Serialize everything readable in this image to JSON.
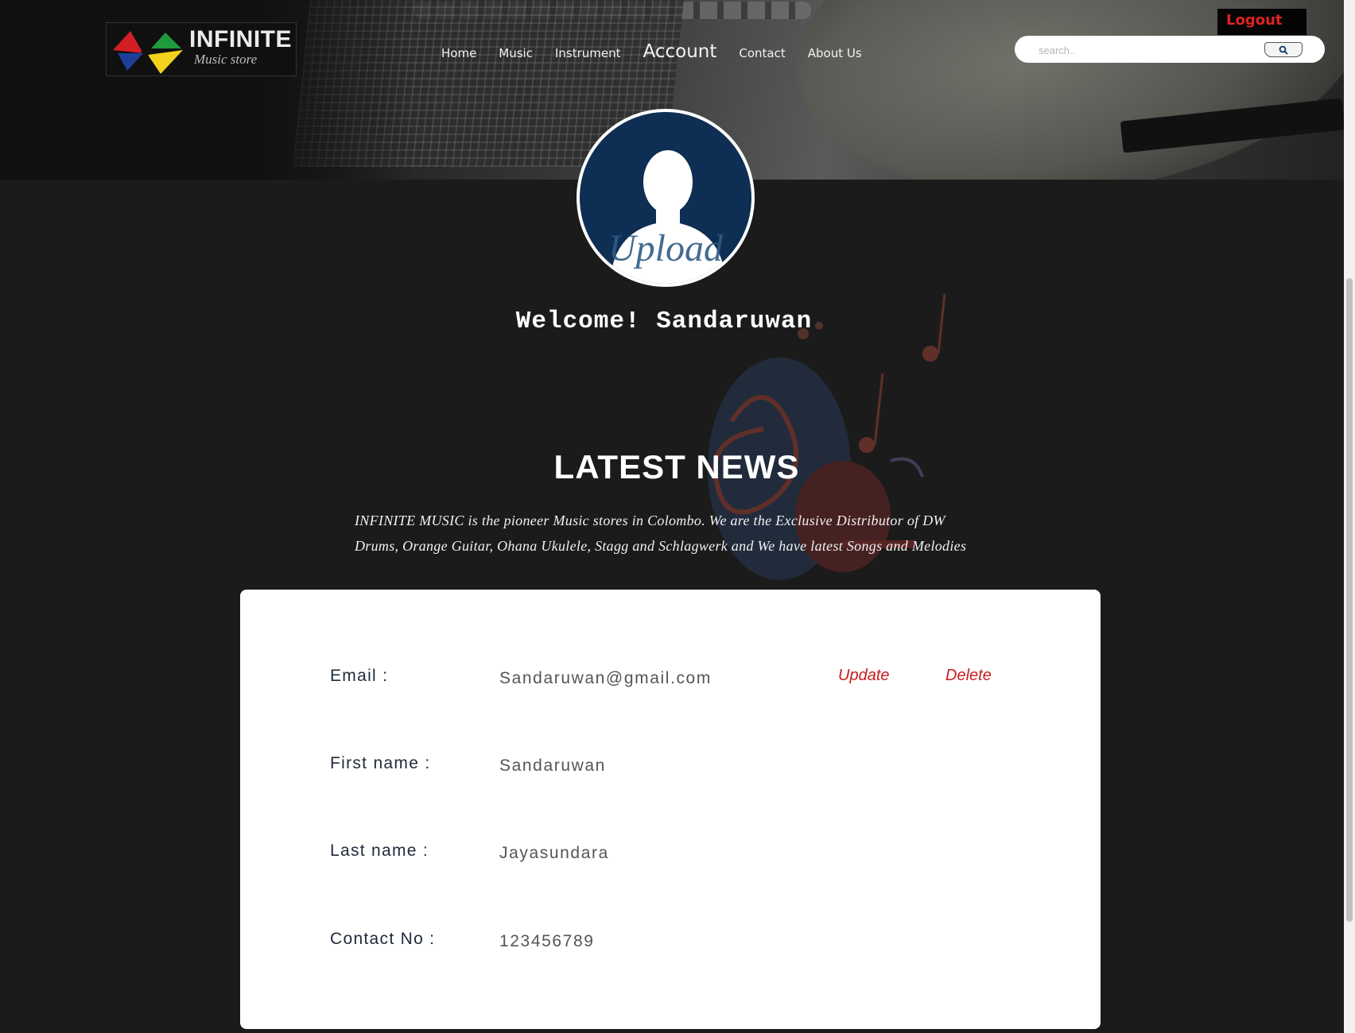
{
  "brand": {
    "name": "INFINITE",
    "tagline": "Music store"
  },
  "nav": {
    "items": [
      {
        "label": "Home"
      },
      {
        "label": "Music"
      },
      {
        "label": "Instrument"
      },
      {
        "label": "Account",
        "active": true
      },
      {
        "label": "Contact"
      },
      {
        "label": "About Us"
      }
    ]
  },
  "header": {
    "logout_label": "Logout"
  },
  "search": {
    "placeholder": "search..",
    "value": "",
    "button_icon": "search-icon"
  },
  "avatar": {
    "overlay_text": "Upload"
  },
  "welcome": {
    "text": "Welcome! Sandaruwan"
  },
  "news": {
    "title": "LATEST NEWS",
    "body": "INFINITE MUSIC is the pioneer Music stores in Colombo. We are the Exclusive Distributor of DW Drums, Orange Guitar, Ohana Ukulele, Stagg and Schlagwerk and We have latest Songs and Melodies"
  },
  "account": {
    "email_label": "Email :",
    "email_value": "Sandaruwan@gmail.com",
    "first_name_label": "First name :",
    "first_name_value": "Sandaruwan",
    "last_name_label": "Last name :",
    "last_name_value": "Jayasundara",
    "contact_label": "Contact No :",
    "contact_value": "123456789",
    "update_label": "Update",
    "delete_label": "Delete"
  },
  "colors": {
    "page_bg": "#1b1b1b",
    "accent_red": "#c81d1d",
    "logout_red": "#e02121",
    "avatar_blue": "#0e2f53",
    "card_bg": "#ffffff"
  }
}
